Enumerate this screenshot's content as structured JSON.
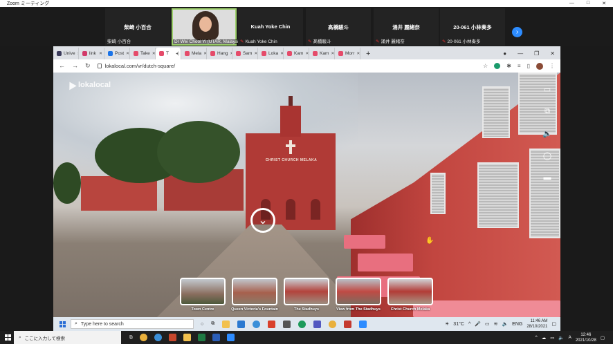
{
  "zoom": {
    "title": "Zoom ミーティング",
    "participants": [
      {
        "big": "柴崎 小百合",
        "small": "柴崎 小百合",
        "muted": false
      },
      {
        "big": "",
        "small": "Dr Wei Chooi Yi (UTAR, Malaysia)",
        "muted": false,
        "active": true
      },
      {
        "big": "Kuah Yoke Chin",
        "small": "Kuah Yoke Chin",
        "muted": true
      },
      {
        "big": "髙橋駿斗",
        "small": "髙橋駿斗",
        "muted": true
      },
      {
        "big": "涌井 麗緒奈",
        "small": "涌井 麗緒奈",
        "muted": true
      },
      {
        "big": "20-061 小林奏多",
        "small": "20-061 小林奏多",
        "muted": true
      }
    ]
  },
  "browser": {
    "tabs": [
      {
        "label": "Unive",
        "color": "#3a3a5a"
      },
      {
        "label": "link",
        "color": "#d23a6a"
      },
      {
        "label": "Post",
        "color": "#1a73e8"
      },
      {
        "label": "Take",
        "color": "#e54b6a"
      },
      {
        "label": "T",
        "color": "#e54b6a",
        "active": true
      },
      {
        "label": "Mela",
        "color": "#e54b6a"
      },
      {
        "label": "Hang",
        "color": "#e54b6a"
      },
      {
        "label": "Sam",
        "color": "#e54b6a"
      },
      {
        "label": "Loka",
        "color": "#e54b6a"
      },
      {
        "label": "Kam",
        "color": "#e54b6a"
      },
      {
        "label": "Kam",
        "color": "#e54b6a"
      },
      {
        "label": "Morr",
        "color": "#e54b6a"
      }
    ],
    "url": "lokalocal.com/vr/dutch-square/"
  },
  "viewer": {
    "logo": "lokalocal",
    "church_sign": "CHRIST  CHURCH  MELAKA",
    "thumbnails": [
      {
        "label": "Town Centre"
      },
      {
        "label": "Queen Victoria's Fountain"
      },
      {
        "label": "The Stadhuys"
      },
      {
        "label": "View from The Stadhuys"
      },
      {
        "label": "Christ Church Melaka"
      }
    ]
  },
  "win_taskbar": {
    "search_placeholder": "Type here to search",
    "temp": "31°C",
    "lang": "ENG",
    "time": "11:46 AM",
    "date": "28/10/2021"
  },
  "host_taskbar": {
    "search_placeholder": "ここに入力して検索",
    "ime": "A",
    "time": "12:46",
    "date": "2021/10/28"
  }
}
